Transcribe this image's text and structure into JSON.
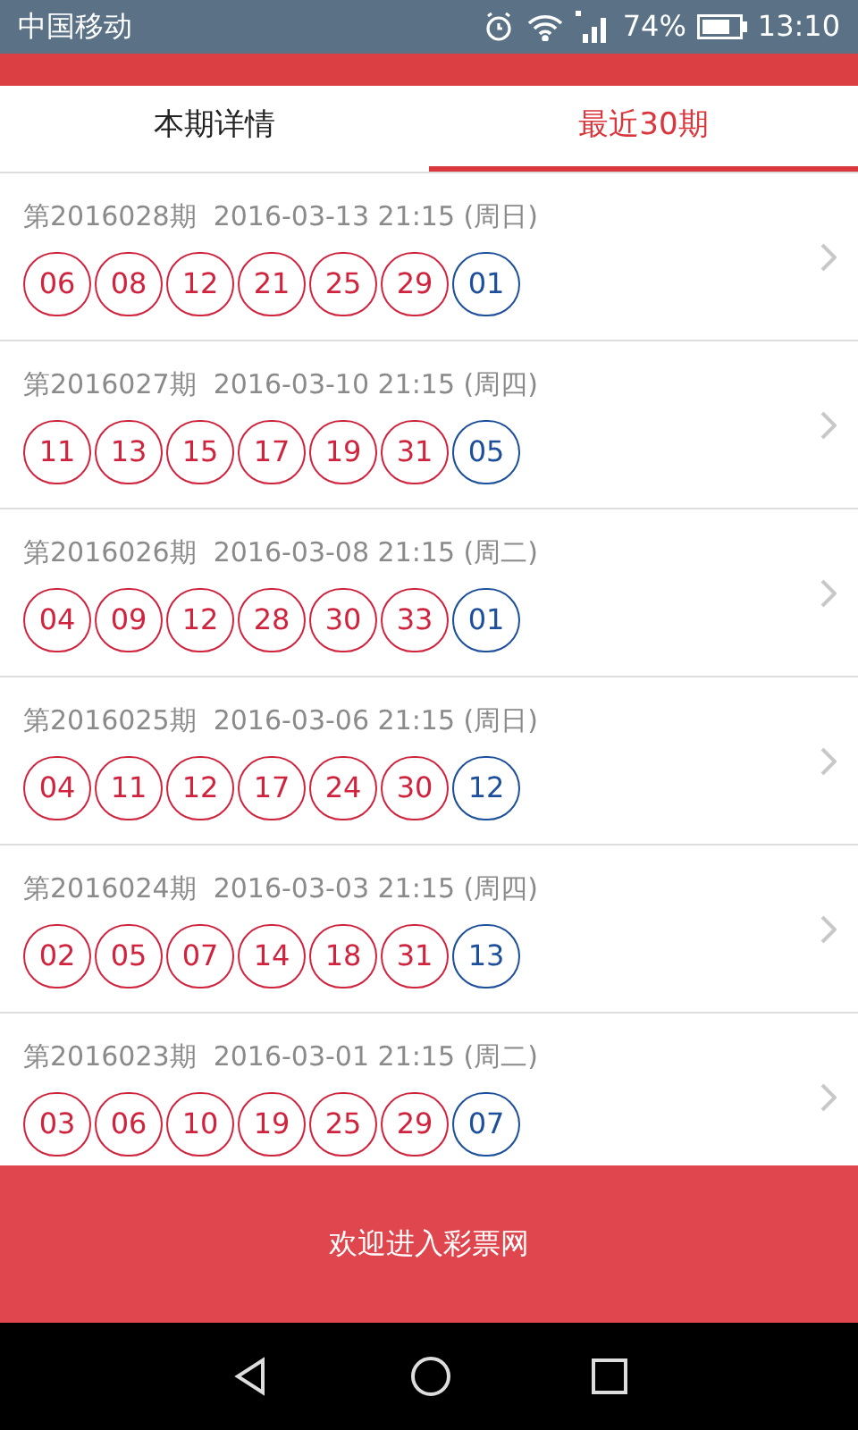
{
  "status_bar": {
    "carrier": "中国移动",
    "battery": "74%",
    "time": "13:10"
  },
  "tabs": [
    {
      "label": "本期详情",
      "selected": false
    },
    {
      "label": "最近30期",
      "selected": true
    }
  ],
  "draws": [
    {
      "title": "第2016028期  2016-03-13 21:15 (周日)",
      "balls": [
        {
          "number": "06",
          "kind": "red"
        },
        {
          "number": "08",
          "kind": "red"
        },
        {
          "number": "12",
          "kind": "red"
        },
        {
          "number": "21",
          "kind": "red"
        },
        {
          "number": "25",
          "kind": "red"
        },
        {
          "number": "29",
          "kind": "red"
        },
        {
          "number": "01",
          "kind": "blue"
        }
      ]
    },
    {
      "title": "第2016027期  2016-03-10 21:15 (周四)",
      "balls": [
        {
          "number": "11",
          "kind": "red"
        },
        {
          "number": "13",
          "kind": "red"
        },
        {
          "number": "15",
          "kind": "red"
        },
        {
          "number": "17",
          "kind": "red"
        },
        {
          "number": "19",
          "kind": "red"
        },
        {
          "number": "31",
          "kind": "red"
        },
        {
          "number": "05",
          "kind": "blue"
        }
      ]
    },
    {
      "title": "第2016026期  2016-03-08 21:15 (周二)",
      "balls": [
        {
          "number": "04",
          "kind": "red"
        },
        {
          "number": "09",
          "kind": "red"
        },
        {
          "number": "12",
          "kind": "red"
        },
        {
          "number": "28",
          "kind": "red"
        },
        {
          "number": "30",
          "kind": "red"
        },
        {
          "number": "33",
          "kind": "red"
        },
        {
          "number": "01",
          "kind": "blue"
        }
      ]
    },
    {
      "title": "第2016025期  2016-03-06 21:15 (周日)",
      "balls": [
        {
          "number": "04",
          "kind": "red"
        },
        {
          "number": "11",
          "kind": "red"
        },
        {
          "number": "12",
          "kind": "red"
        },
        {
          "number": "17",
          "kind": "red"
        },
        {
          "number": "24",
          "kind": "red"
        },
        {
          "number": "30",
          "kind": "red"
        },
        {
          "number": "12",
          "kind": "blue"
        }
      ]
    },
    {
      "title": "第2016024期  2016-03-03 21:15 (周四)",
      "balls": [
        {
          "number": "02",
          "kind": "red"
        },
        {
          "number": "05",
          "kind": "red"
        },
        {
          "number": "07",
          "kind": "red"
        },
        {
          "number": "14",
          "kind": "red"
        },
        {
          "number": "18",
          "kind": "red"
        },
        {
          "number": "31",
          "kind": "red"
        },
        {
          "number": "13",
          "kind": "blue"
        }
      ]
    },
    {
      "title": "第2016023期  2016-03-01 21:15 (周二)",
      "balls": [
        {
          "number": "03",
          "kind": "red"
        },
        {
          "number": "06",
          "kind": "red"
        },
        {
          "number": "10",
          "kind": "red"
        },
        {
          "number": "19",
          "kind": "red"
        },
        {
          "number": "25",
          "kind": "red"
        },
        {
          "number": "29",
          "kind": "red"
        },
        {
          "number": "07",
          "kind": "blue"
        }
      ]
    }
  ],
  "banner": "欢迎进入彩票网"
}
